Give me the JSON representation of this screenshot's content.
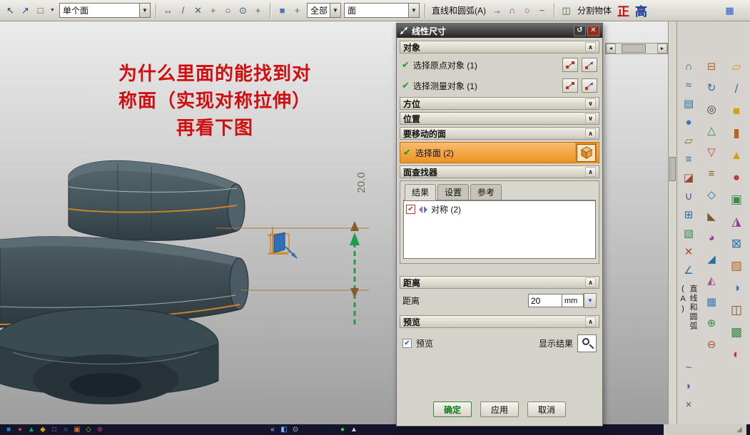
{
  "glyphs": {
    "check": "✔",
    "collapse": "∧",
    "expand": "∨",
    "close": "✕",
    "reset": "↺",
    "dropdown": "▼",
    "left_arrow": "◄",
    "right_arrow": "►"
  },
  "top_toolbar": {
    "face_rule_value": "单个面",
    "scope_value": "全部",
    "type_value": "面",
    "curve_label": "直线和圆弧(A)",
    "split_label": "分割物体",
    "stamp_red": "正",
    "stamp_blue": "高"
  },
  "viewport": {
    "annotation_line1": "为什么里面的能找到对",
    "annotation_line2": "称面（实现对称拉伸）",
    "annotation_line3": "再看下图",
    "dimension_label": "20.0"
  },
  "dialog": {
    "title": "线性尺寸",
    "object_section": {
      "title": "对象",
      "row1_label": "选择原点对象 (1)",
      "row2_label": "选择测量对象 (1)"
    },
    "orientation_section": {
      "title": "方位"
    },
    "position_section": {
      "title": "位置"
    },
    "faces_section": {
      "title": "要移动的面",
      "select_label": "选择面 (2)"
    },
    "finder_section": {
      "title": "面查找器",
      "tabs": [
        "结果",
        "设置",
        "参考"
      ],
      "item_label": "对称 (2)"
    },
    "distance_section": {
      "title": "距离",
      "label": "距离",
      "value": "20",
      "unit": "mm"
    },
    "preview_section": {
      "title": "预览",
      "checkbox_label": "预览",
      "result_label": "显示结果"
    },
    "buttons": {
      "ok": "确定",
      "apply": "应用",
      "cancel": "取消"
    }
  },
  "right_toolbar": {
    "vertical_label": "直线和圆弧(A)"
  },
  "icons": {
    "top_left": [
      {
        "name": "select-cursor-icon",
        "glyph": "↖",
        "color": "#17408b"
      },
      {
        "name": "lasso-select-icon",
        "glyph": "↗",
        "color": "#17408b"
      },
      {
        "name": "marquee-select-icon",
        "glyph": "□",
        "color": "#445566"
      }
    ],
    "top_mid": [
      {
        "name": "pan-icon",
        "glyph": "↔",
        "color": "#3a5a7a"
      },
      {
        "name": "line-snap-icon",
        "glyph": "/",
        "color": "#3a5a7a"
      },
      {
        "name": "erase-icon",
        "glyph": "✕",
        "color": "#3a5a7a"
      },
      {
        "name": "point-snap-icon",
        "glyph": "+",
        "color": "#8a6a2a"
      },
      {
        "name": "circle-snap-icon",
        "glyph": "○",
        "color": "#3a5a7a"
      },
      {
        "name": "center-snap-icon",
        "glyph": "⊙",
        "color": "#3a5a7a"
      },
      {
        "name": "add-snap-icon",
        "glyph": "+",
        "color": "#2a7a2a"
      }
    ],
    "top_cube": [
      {
        "name": "solid-body-icon",
        "glyph": "■",
        "color": "#4a7ab5"
      },
      {
        "name": "add-body-icon",
        "glyph": "+",
        "color": "#2a8a2a"
      }
    ],
    "top_curve": [
      {
        "name": "arrow-tool-icon",
        "glyph": "→",
        "color": "#2a5a9a"
      },
      {
        "name": "arc-tool-icon",
        "glyph": "∩",
        "color": "#8a3a9a"
      },
      {
        "name": "circle-tool-icon",
        "glyph": "○",
        "color": "#8a3a9a"
      },
      {
        "name": "spline-tool-icon",
        "glyph": "~",
        "color": "#2a5a9a"
      }
    ],
    "top_split": [
      {
        "name": "split-body-icon",
        "glyph": "◫",
        "color": "#3a6a3a"
      }
    ],
    "top_far_right": [
      {
        "name": "panel-toggle-icon",
        "glyph": "▦",
        "color": "#2a5ad2"
      }
    ],
    "right_col_a": [
      {
        "name": "through-curves-icon",
        "glyph": "∩",
        "color": "#2a7f8f"
      },
      {
        "name": "swept-surface-icon",
        "glyph": "≈",
        "color": "#2a6fa0"
      },
      {
        "name": "ruled-surface-icon",
        "glyph": "▤",
        "color": "#2a6fa0"
      },
      {
        "name": "sphere-icon",
        "glyph": "●",
        "color": "#3a7ab5"
      },
      {
        "name": "bounded-plane-icon",
        "glyph": "▱",
        "color": "#8a6a2a"
      },
      {
        "name": "offset-surface-icon",
        "glyph": "≡",
        "color": "#2a6fa0"
      },
      {
        "name": "trim-sheet-icon",
        "glyph": "◪",
        "color": "#9a4a2a"
      },
      {
        "name": "sew-icon",
        "glyph": "∪",
        "color": "#7a3aa0"
      },
      {
        "name": "thicken-icon",
        "glyph": "⊞",
        "color": "#2a6fa0"
      },
      {
        "name": "patch-icon",
        "glyph": "▧",
        "color": "#3a8a4a"
      },
      {
        "name": "delete-face-icon",
        "glyph": "✕",
        "color": "#b04a2a"
      },
      {
        "name": "draft-angle-icon",
        "glyph": "∠",
        "color": "#2a6fa0"
      }
    ],
    "right_col_a_tail": [
      {
        "name": "studio-spline-icon",
        "glyph": "~",
        "color": "#2a6fa0"
      },
      {
        "name": "blend-corner-icon",
        "glyph": "◗",
        "color": "#8a4a9a"
      },
      {
        "name": "snip-surface-icon",
        "glyph": "×",
        "color": "#555555"
      }
    ],
    "right_col_b": [
      {
        "name": "extrude-icon",
        "glyph": "⊟",
        "color": "#b5651d"
      },
      {
        "name": "revolve-icon",
        "glyph": "↻",
        "color": "#2a6fa0"
      },
      {
        "name": "hole-icon",
        "glyph": "◎",
        "color": "#3a3a3a"
      },
      {
        "name": "boss-icon",
        "glyph": "△",
        "color": "#3a8a4a"
      },
      {
        "name": "pocket-icon",
        "glyph": "▽",
        "color": "#b04a2a"
      },
      {
        "name": "rib-icon",
        "glyph": "≡",
        "color": "#8a6a2a"
      },
      {
        "name": "shell-icon",
        "glyph": "◇",
        "color": "#2a6fa0"
      },
      {
        "name": "chamfer-icon",
        "glyph": "◣",
        "color": "#7a5a2a"
      },
      {
        "name": "edge-blend-icon",
        "glyph": "◕",
        "color": "#9a3a9a"
      },
      {
        "name": "taper-icon",
        "glyph": "◢",
        "color": "#2a6fa0"
      },
      {
        "name": "mirror-feature-icon",
        "glyph": "◭",
        "color": "#b04a8a"
      },
      {
        "name": "pattern-icon",
        "glyph": "▦",
        "color": "#3a7ab5"
      },
      {
        "name": "boolean-unite-icon",
        "glyph": "⊕",
        "color": "#3a8a4a"
      },
      {
        "name": "boolean-subtract-icon",
        "glyph": "⊖",
        "color": "#b04a2a"
      }
    ],
    "right_col_c": [
      {
        "name": "datum-plane-icon",
        "glyph": "▱",
        "color": "#d4a017"
      },
      {
        "name": "datum-axis-icon",
        "glyph": "/",
        "color": "#2a6fa0"
      },
      {
        "name": "block-primitive-icon",
        "glyph": "■",
        "color": "#d4a017"
      },
      {
        "name": "cylinder-primitive-icon",
        "glyph": "▮",
        "color": "#b5651d"
      },
      {
        "name": "cone-primitive-icon",
        "glyph": "▲",
        "color": "#d4a017"
      },
      {
        "name": "sphere-primitive-icon",
        "glyph": "●",
        "color": "#c23b3b"
      },
      {
        "name": "instance-icon",
        "glyph": "▣",
        "color": "#3a8a4a"
      },
      {
        "name": "mirror-body-icon",
        "glyph": "◮",
        "color": "#9a3a9a"
      },
      {
        "name": "promote-body-icon",
        "glyph": "⊠",
        "color": "#2a6fa0"
      },
      {
        "name": "sketch-icon",
        "glyph": "▨",
        "color": "#b5651d"
      },
      {
        "name": "expression-icon",
        "glyph": "◑",
        "color": "#3a7ab5"
      },
      {
        "name": "measure-icon",
        "glyph": "◫",
        "color": "#7a5a2a"
      },
      {
        "name": "layer-settings-icon",
        "glyph": "▩",
        "color": "#3a8a4a"
      },
      {
        "name": "view-orient-icon",
        "glyph": "◐",
        "color": "#c23b3b"
      }
    ],
    "bottom_left": [
      {
        "name": "taskbar-icon-1",
        "glyph": "■",
        "color": "#2a7ad2"
      },
      {
        "name": "taskbar-icon-2",
        "glyph": "●",
        "color": "#d23b2a"
      },
      {
        "name": "taskbar-icon-3",
        "glyph": "▲",
        "color": "#2aa05a"
      },
      {
        "name": "taskbar-icon-4",
        "glyph": "◆",
        "color": "#d4a017"
      },
      {
        "name": "taskbar-icon-5",
        "glyph": "□",
        "color": "#9a6ad2"
      },
      {
        "name": "taskbar-icon-6",
        "glyph": "○",
        "color": "#2ac0c0"
      },
      {
        "name": "taskbar-icon-7",
        "glyph": "▣",
        "color": "#d2702a"
      },
      {
        "name": "taskbar-icon-8",
        "glyph": "◇",
        "color": "#8ad22a"
      },
      {
        "name": "taskbar-icon-9",
        "glyph": "⊕",
        "color": "#d22a8a"
      }
    ],
    "bottom_mid": [
      {
        "name": "collapse-tray-icon",
        "glyph": "«",
        "color": "#cfd6e8"
      },
      {
        "name": "ime-icon",
        "glyph": "◧",
        "color": "#7ab0ff"
      },
      {
        "name": "tray-app-icon",
        "glyph": "⊙",
        "color": "#d0d0d0"
      }
    ],
    "bottom_green": [
      {
        "name": "status-ok-icon",
        "glyph": "●",
        "color": "#35d24a"
      },
      {
        "name": "network-icon",
        "glyph": "▲",
        "color": "#cccccc"
      }
    ],
    "bottom_right": [
      {
        "name": "resize-grip-icon",
        "glyph": "◢",
        "color": "#8a867c"
      }
    ]
  }
}
